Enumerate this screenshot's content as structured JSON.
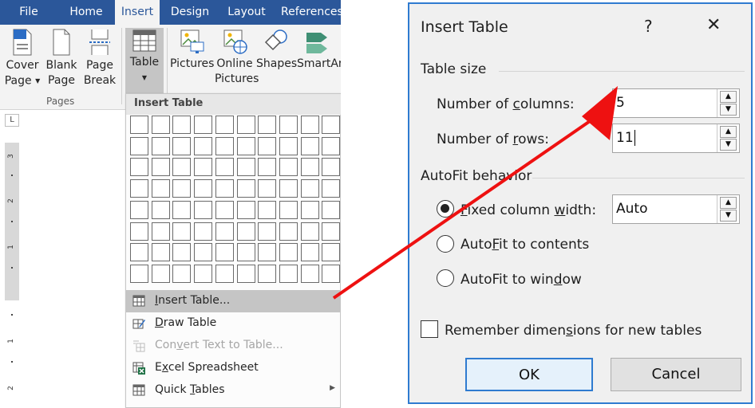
{
  "ribbon": {
    "tabs": [
      "File",
      "Home",
      "Insert",
      "Design",
      "Layout",
      "References"
    ],
    "active_tab": "Insert",
    "buttons": {
      "cover_page": [
        "Cover",
        "Page"
      ],
      "blank_page": [
        "Blank",
        "Page"
      ],
      "page_break": [
        "Page",
        "Break"
      ],
      "table": "Table",
      "pictures": "Pictures",
      "online_pictures": [
        "Online",
        "Pictures"
      ],
      "shapes": "Shapes",
      "smartart": "SmartArt"
    },
    "group_pages_label": "Pages",
    "colors": {
      "tab_bar": "#2b579a",
      "ribbon_bg": "#f3f3f3"
    }
  },
  "ruler": {
    "corner": "L",
    "numbers": [
      "3",
      "2",
      "1",
      "1",
      "2"
    ]
  },
  "dropdown": {
    "header": "Insert Table",
    "grid": {
      "cols": 10,
      "rows": 8
    },
    "items": [
      {
        "label": "Insert Table...",
        "underline": "I",
        "icon": "table-icon",
        "highlighted": true,
        "disabled": false
      },
      {
        "label": "Draw Table",
        "underline": "D",
        "icon": "pencil-table-icon",
        "highlighted": false,
        "disabled": false
      },
      {
        "label": "Convert Text to Table...",
        "underline": "v",
        "icon": "convert-icon",
        "highlighted": false,
        "disabled": true
      },
      {
        "label": "Excel Spreadsheet",
        "underline": "x",
        "icon": "excel-icon",
        "highlighted": false,
        "disabled": false
      },
      {
        "label": "Quick Tables",
        "underline": "T",
        "icon": "table-icon",
        "highlighted": false,
        "disabled": false,
        "submenu": true
      }
    ]
  },
  "dialog": {
    "title": "Insert Table",
    "help": "?",
    "close": "✕",
    "table_size_label": "Table size",
    "columns_label": {
      "before": "Number of ",
      "key": "c",
      "after": "olumns:"
    },
    "columns_value": "5",
    "rows_label": {
      "before": "Number of ",
      "key": "r",
      "after": "ows:"
    },
    "rows_value": "11",
    "autofit_label": "AutoFit behavior",
    "fixed_label": {
      "before": "",
      "key": "F",
      "after": "ixed column ",
      "key2": "w",
      "after2": "idth:"
    },
    "fixed_value": "Auto",
    "contents_label": {
      "before": "AutoFit to ",
      "key": "c",
      "pre": "AutoFit to ",
      "full": "AutoFit to contents"
    },
    "window_label": {
      "full": "AutoFit to window"
    },
    "remember_label": {
      "before": "Remember dimen",
      "key": "s",
      "after": "ions for new tables"
    },
    "ok": "OK",
    "cancel": "Cancel",
    "selected_radio": "fixed",
    "remember_checked": false
  },
  "annotation": {
    "arrow_color": "#ee1111"
  }
}
